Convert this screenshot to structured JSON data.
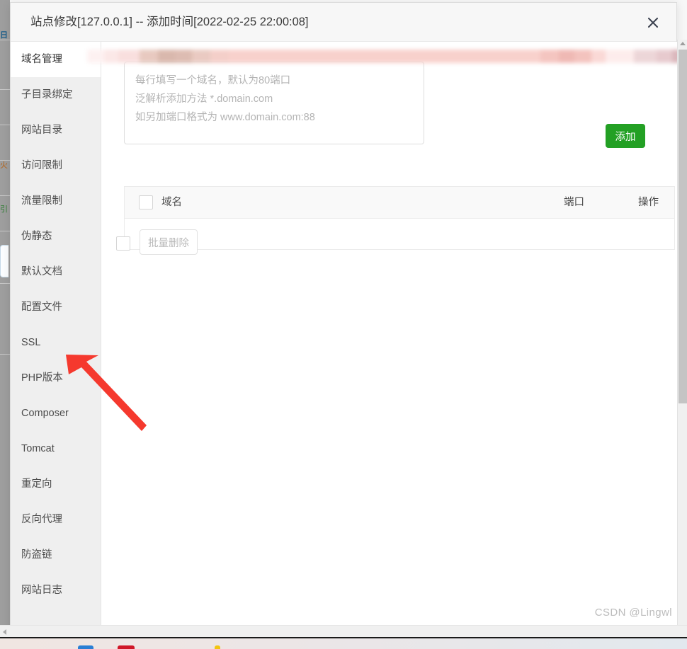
{
  "modal": {
    "title": "站点修改[127.0.0.1] -- 添加时间[2022-02-25 22:00:08]",
    "close_icon": "close-icon"
  },
  "sidebar": {
    "active_index": 0,
    "items": [
      {
        "label": "域名管理"
      },
      {
        "label": "子目录绑定"
      },
      {
        "label": "网站目录"
      },
      {
        "label": "访问限制"
      },
      {
        "label": "流量限制"
      },
      {
        "label": "伪静态"
      },
      {
        "label": "默认文档"
      },
      {
        "label": "配置文件"
      },
      {
        "label": "SSL"
      },
      {
        "label": "PHP版本"
      },
      {
        "label": "Composer"
      },
      {
        "label": "Tomcat"
      },
      {
        "label": "重定向"
      },
      {
        "label": "反向代理"
      },
      {
        "label": "防盗链"
      },
      {
        "label": "网站日志"
      }
    ]
  },
  "add_panel": {
    "textarea_value": "",
    "textarea_placeholder": "每行填写一个域名，默认为80端口\n泛解析添加方法 *.domain.com\n如另加端口格式为 www.domain.com:88",
    "add_button_label": "添加",
    "add_button_color": "#23a024"
  },
  "table": {
    "columns": [
      "域名",
      "端口",
      "操作"
    ],
    "select_all_checked": false,
    "rows": [
      {
        "domain": "",
        "port": "",
        "action": "",
        "redacted": true
      }
    ]
  },
  "footer": {
    "select_all_checked": false,
    "bulk_delete_label": "批量删除",
    "bulk_delete_disabled": true
  },
  "annotation": {
    "type": "arrow",
    "color": "#f5392e",
    "points_to": "配置文件"
  },
  "watermark": {
    "text": "CSDN @Lingwl"
  },
  "scrollbars": {
    "vertical_present": true,
    "horizontal_present": true
  }
}
